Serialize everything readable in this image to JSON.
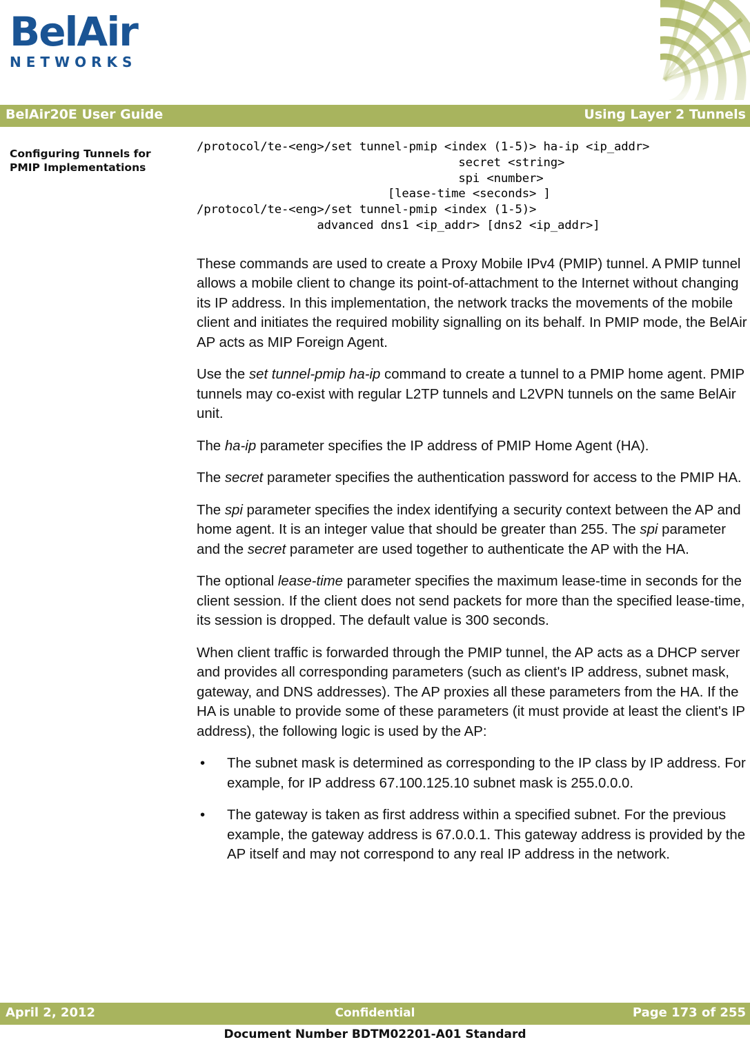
{
  "colors": {
    "band_green": "#A8B45E",
    "logo_blue": "#1A5494",
    "body_text": "#111111",
    "band_text": "#FFFFFF"
  },
  "masthead": {
    "logo_wordmark": "BelAir",
    "logo_subtext": "NETWORKS",
    "decoration_icon": "radial-arc-fan-icon"
  },
  "header": {
    "left_title": "BelAir20E User Guide",
    "right_title": "Using Layer 2 Tunnels"
  },
  "margin_heading": "Configuring Tunnels for PMIP Implementations",
  "cli_block": "/protocol/te-<eng>/set tunnel-pmip <index (1-5)> ha-ip <ip_addr>\n                                     secret <string>\n                                     spi <number>\n                           [lease-time <seconds> ]\n/protocol/te-<eng>/set tunnel-pmip <index (1-5)>\n                 advanced dns1 <ip_addr> [dns2 <ip_addr>]",
  "paragraphs": [
    {
      "id": "p-overview",
      "runs": [
        {
          "t": "These commands are used to create a Proxy Mobile IPv4 (PMIP) tunnel. A PMIP tunnel allows a mobile client to change its point-of-attachment to the Internet without changing its IP address. In this implementation, the network tracks the movements of the mobile client and initiates the required mobility signalling on its behalf. In PMIP mode, the BelAir AP acts as MIP Foreign Agent.",
          "i": false
        }
      ]
    },
    {
      "id": "p-haip-usage",
      "runs": [
        {
          "t": "Use the ",
          "i": false
        },
        {
          "t": "set tunnel-pmip ha-ip",
          "i": true
        },
        {
          "t": " command to create a tunnel to a PMIP home agent. PMIP tunnels may co-exist with regular L2TP tunnels and L2VPN tunnels on the same BelAir unit.",
          "i": false
        }
      ]
    },
    {
      "id": "p-haip",
      "runs": [
        {
          "t": "The ",
          "i": false
        },
        {
          "t": "ha-ip",
          "i": true
        },
        {
          "t": " parameter specifies the IP address of PMIP Home Agent (HA).",
          "i": false
        }
      ]
    },
    {
      "id": "p-secret",
      "runs": [
        {
          "t": "The ",
          "i": false
        },
        {
          "t": "secret",
          "i": true
        },
        {
          "t": " parameter specifies the authentication password for access to the PMIP HA.",
          "i": false
        }
      ]
    },
    {
      "id": "p-spi",
      "runs": [
        {
          "t": "The ",
          "i": false
        },
        {
          "t": "spi",
          "i": true
        },
        {
          "t": " parameter specifies the index identifying a security context between the AP and home agent. It is an integer value that should be greater than 255. The ",
          "i": false
        },
        {
          "t": "spi",
          "i": true
        },
        {
          "t": " parameter and the ",
          "i": false
        },
        {
          "t": "secret",
          "i": true
        },
        {
          "t": " parameter are used together to authenticate the AP with the HA.",
          "i": false
        }
      ]
    },
    {
      "id": "p-lease-time",
      "runs": [
        {
          "t": "The optional ",
          "i": false
        },
        {
          "t": "lease-time",
          "i": true
        },
        {
          "t": " parameter specifies the maximum lease-time in seconds for the client session. If the client does not send packets for more than the specified lease-time, its session is dropped. The default value is 300 seconds.",
          "i": false
        }
      ]
    },
    {
      "id": "p-dhcp",
      "runs": [
        {
          "t": "When client traffic is forwarded through the PMIP tunnel, the AP acts as a DHCP server and provides all corresponding parameters (such as client's IP address, subnet mask, gateway, and DNS addresses). The AP proxies all these parameters from the HA. If the HA is unable to provide some of these parameters (it must provide at least the client's IP address), the following logic is used by the AP:",
          "i": false
        }
      ]
    }
  ],
  "bullets": [
    {
      "id": "bullet-subnet-mask",
      "marker": "•",
      "text": "The subnet mask is determined as corresponding to the IP class by IP address. For example, for IP address 67.100.125.10 subnet mask is 255.0.0.0."
    },
    {
      "id": "bullet-gateway",
      "marker": "•",
      "text": "The gateway is taken as first address within a specified subnet. For the previous example, the gateway address is 67.0.0.1. This gateway address is provided by the AP itself and may not correspond to any real IP address in the network."
    }
  ],
  "footer": {
    "date": "April 2, 2012",
    "classification": "Confidential",
    "page": "Page 173 of 255",
    "document_number": "Document Number BDTM02201-A01 Standard"
  }
}
